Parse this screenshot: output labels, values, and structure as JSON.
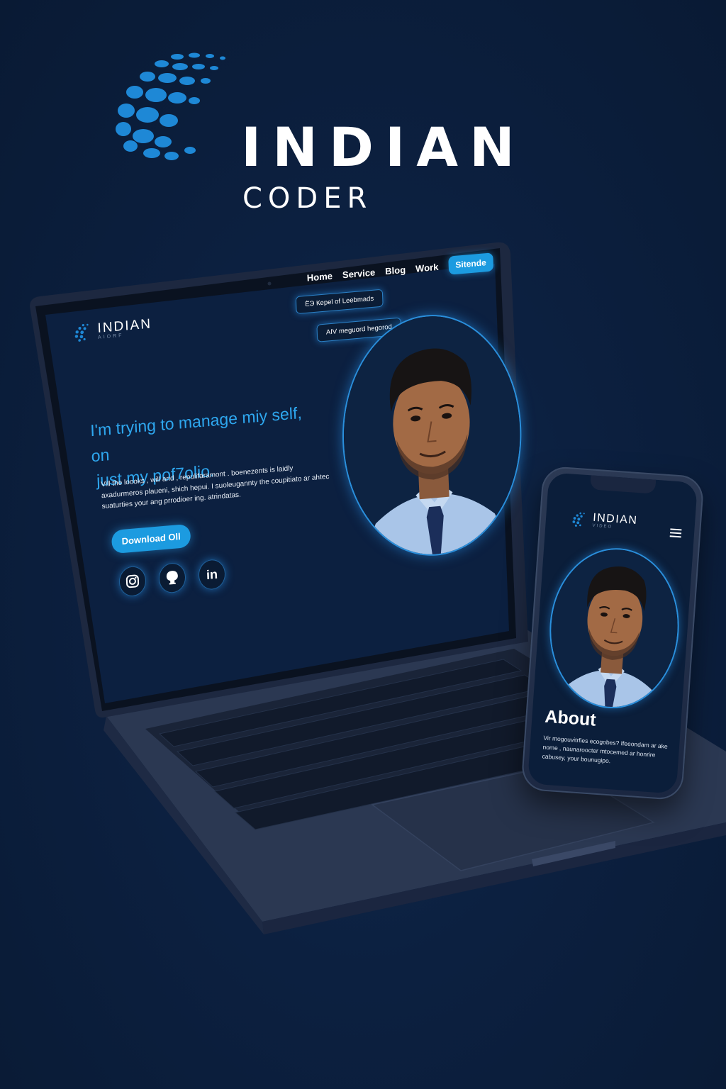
{
  "brand": {
    "name": "INDIAN",
    "tagline": "CODER",
    "accent_color": "#1c9be0",
    "background_color": "#0c2040"
  },
  "laptop_site": {
    "nav": {
      "items": [
        "Home",
        "Service",
        "Blog",
        "Work"
      ],
      "cta_label": "Sitende"
    },
    "logo": {
      "name": "INDIAN",
      "tagline": "AIORF"
    },
    "floating_pills": [
      "ЁЭ Кepel of Leebmads",
      "AIV meguord hegorod"
    ],
    "headline_line1": "I'm trying to manage miy self, on",
    "headline_line2": "just my pof7olio.",
    "body_text": "Vill the loooks , will and , repulifaramont . boenezents is laidly axadurmeros plaueni, shich hepui. I suoleugannty the coupitiato ar ahtec suaturties your ang prrodioer ing. atrindatas.",
    "download_button_label": "Download Oll",
    "social": [
      {
        "icon": "instagram-icon"
      },
      {
        "icon": "github-icon"
      },
      {
        "icon": "linkedin-icon",
        "label": "in"
      }
    ]
  },
  "phone_site": {
    "logo": {
      "name": "INDIAN",
      "tagline": "VIDEO"
    },
    "menu_icon": "hamburger-menu-icon",
    "section_heading": "About",
    "body_text": "Vir mogouvitrfies ecogobes? Ifeeondam ar ake nome , naunaroocter mtocemed ar honrire cabusey, your bounugipo."
  }
}
